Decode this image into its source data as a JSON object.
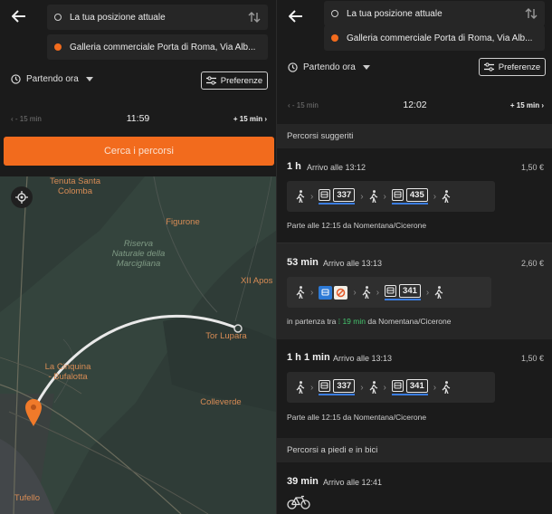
{
  "left": {
    "origin": "La tua posizione attuale",
    "destination": "Galleria commerciale Porta di Roma, Via Alb...",
    "depart_mode": "Partendo ora",
    "preferences": "Preferenze",
    "time_minus": "- 15 min",
    "time_current": "11:59",
    "time_plus": "+ 15 min",
    "cta": "Cerca i percorsi",
    "map_places": {
      "tenuta": "Tenuta Santa\nColomba",
      "figurone": "Figurone",
      "riserva": "Riserva\nNaturale della\nMarciglianа",
      "xii": "XII Apos",
      "tor_lupara": "Tor Lupara",
      "cinquina": "La Cinquina\n- Bufalotta",
      "colleverde": "Colleverde",
      "tufello": "Tufello"
    }
  },
  "right": {
    "origin": "La tua posizione attuale",
    "destination": "Galleria commerciale Porta di Roma, Via Alb...",
    "depart_mode": "Partendo ora",
    "preferences": "Preferenze",
    "time_minus": "- 15 min",
    "time_current": "12:02",
    "time_plus": "+ 15 min",
    "suggested_header": "Percorsi suggeriti",
    "routes": [
      {
        "duration": "1 h",
        "arrival": "Arrivo alle 13:12",
        "price": "1,50 €",
        "bus1": "337",
        "bus2": "435",
        "info": "Parte alle 12:15 da Nomentana/Cicerone"
      },
      {
        "duration": "53 min",
        "arrival": "Arrivo alle 13:13",
        "price": "2,60 €",
        "bus1": "341",
        "info_prefix": "in partenza tra",
        "info_eta": "19 min",
        "info_suffix": "da Nomentana/Cicerone"
      },
      {
        "duration": "1 h 1 min",
        "arrival": "Arrivo alle 13:13",
        "price": "1,50 €",
        "bus1": "337",
        "bus2": "341",
        "info": "Parte alle 12:15 da Nomentana/Cicerone"
      }
    ],
    "walk_header": "Percorsi a piedi e in bici",
    "walk": {
      "duration": "39 min",
      "arrival": "Arrivo alle 12:41"
    }
  },
  "colors": {
    "accent": "#f26b1d",
    "bus_line": "#3b7de0",
    "live": "#45c46e"
  }
}
